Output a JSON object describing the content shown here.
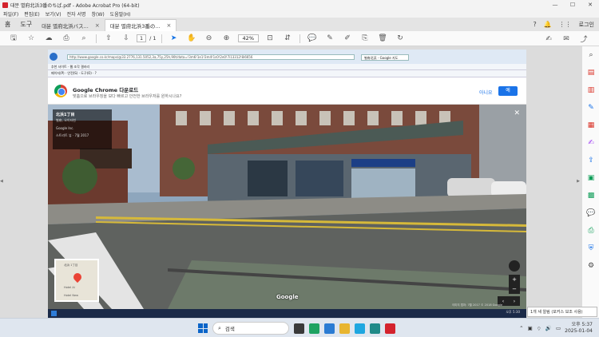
{
  "window": {
    "title": "대분 별府北浜3番のちば.pdf - Adobe Acrobat Pro (64-bit)",
    "minimize": "—",
    "maximize": "☐",
    "close": "✕"
  },
  "menu": [
    "파일(F)",
    "편집(E)",
    "보기(V)",
    "전자 서명",
    "창(W)",
    "도움말(H)"
  ],
  "tabs": {
    "home": "홈",
    "tools": "도구",
    "items": [
      {
        "label": "대분 별府北浜バス...",
        "close": "×"
      },
      {
        "label": "대분 별府北浜3番の...",
        "close": "×"
      }
    ],
    "login": "로그인"
  },
  "toolbar": {
    "current_page": "1",
    "total_pages": "/ 1",
    "zoom": "42%"
  },
  "document": {
    "ie": {
      "address": "http://www.google.co.kr/maps/@33.2776,131.5052,3a,75y,25h,90t/data=!3m6!1e1!3m4!1s0!2e0!7i13312!8i6656",
      "tab": "별府北浜 - Google 지도",
      "favorites": "추천 사이트 · 웹 조각 갤러리",
      "commandbar": "페이지(P) · 안전(S) · 도구(O) · ?"
    },
    "promo": {
      "title": "Google Chrome 다운로드",
      "subtitle": "맞춤으로 브라우징을 보다 빠르고 안전한 브라우저를 원하시나요?",
      "no": "아니요",
      "yes": "예"
    },
    "streetview": {
      "card_address": "北浜1丁目",
      "card_sub": "별府, 오이타현",
      "card_row1": "Google Inc.",
      "card_row2": "스트리트 뷰 · 7월 2017",
      "close": "✕",
      "google": "Google",
      "minimap_labels": [
        "北浜 1丁目",
        "Hotel Ai",
        "Hotel New"
      ],
      "zoom_in": "+",
      "zoom_out": "−",
      "credit": "이미지 캡처: 7월 2017 © 2018 Google"
    },
    "taskbar_clock": "오후 5:30"
  },
  "toast": "1개 새 알림 (포커스 보조 사용)",
  "taskbar": {
    "search": "검색",
    "time": "오후 5:37",
    "date": "2025-01-04"
  }
}
